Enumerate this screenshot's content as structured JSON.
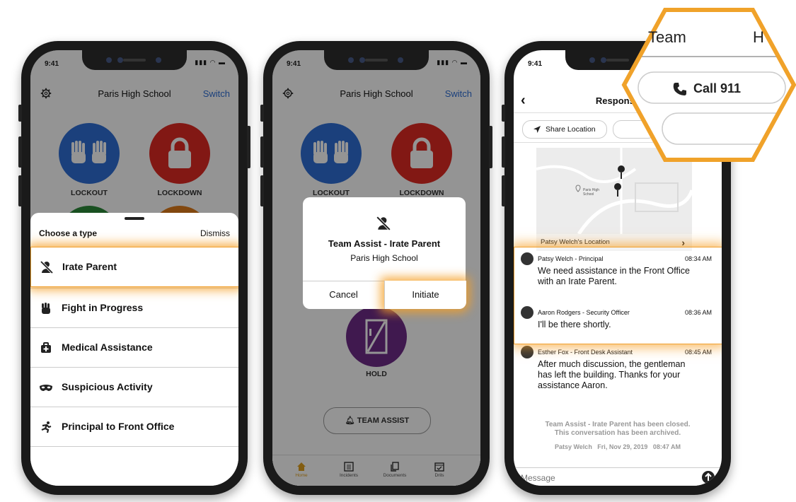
{
  "status": {
    "time": "9:41"
  },
  "colors": {
    "accent": "#2f6fd6",
    "highlight": "#f0a030",
    "lockout": "#2f6fd6",
    "lockdown": "#e02a24",
    "hold": "#6e2c88"
  },
  "phone1": {
    "header": {
      "title": "Paris High School",
      "switch_label": "Switch"
    },
    "actions": [
      {
        "label": "LOCKOUT",
        "icon": "raised-hands-icon"
      },
      {
        "label": "LOCKDOWN",
        "icon": "padlock-icon"
      }
    ],
    "sheet": {
      "title": "Choose a type",
      "dismiss": "Dismiss",
      "items": [
        {
          "label": "Irate Parent",
          "icon": "person-slash-icon"
        },
        {
          "label": "Fight in Progress",
          "icon": "fist-icon"
        },
        {
          "label": "Medical Assistance",
          "icon": "medical-kit-icon"
        },
        {
          "label": "Suspicious Activity",
          "icon": "mask-icon"
        },
        {
          "label": "Principal to Front Office",
          "icon": "running-person-icon"
        }
      ]
    }
  },
  "phone2": {
    "header": {
      "title": "Paris High School",
      "switch_label": "Switch"
    },
    "actions": [
      {
        "label": "LOCKOUT"
      },
      {
        "label": "LOCKDOWN"
      },
      {
        "label": "HOLD"
      }
    ],
    "dialog": {
      "title": "Team Assist - Irate Parent",
      "subtitle": "Paris High School",
      "cancel": "Cancel",
      "initiate": "Initiate"
    },
    "team_assist": "TEAM ASSIST",
    "tabs": [
      {
        "label": "Home",
        "icon": "home-icon"
      },
      {
        "label": "Incidents",
        "icon": "list-icon"
      },
      {
        "label": "Documents",
        "icon": "documents-icon"
      },
      {
        "label": "Drils",
        "icon": "calendar-icon"
      }
    ]
  },
  "phone3": {
    "title": "Response",
    "share_location": "Share Location",
    "map": {
      "place_label": "Paris High School",
      "location_label": "Patsy Welch's Location"
    },
    "messages": [
      {
        "author": "Patsy Welch - Principal",
        "time": "08:34 AM",
        "text": "We need assistance in the Front Office with an Irate Parent."
      },
      {
        "author": "Aaron Rodgers - Security Officer",
        "time": "08:36 AM",
        "text": "I'll be there shortly."
      },
      {
        "author": "Esther Fox - Front Desk Assistant",
        "time": "08:45 AM",
        "text": "After much discussion, the gentleman has left the building. Thanks for your assistance Aaron."
      }
    ],
    "closed_note_1": "Team Assist - Irate Parent has been closed.",
    "closed_note_2": "This conversation has been archived.",
    "closed_by": "Patsy Welch   Fri, Nov 29, 2019   08:47 AM",
    "message_placeholder": "Message"
  },
  "callout": {
    "tab_partial": "Team",
    "tab_partial_right": "H",
    "call_label": "Call 911"
  }
}
